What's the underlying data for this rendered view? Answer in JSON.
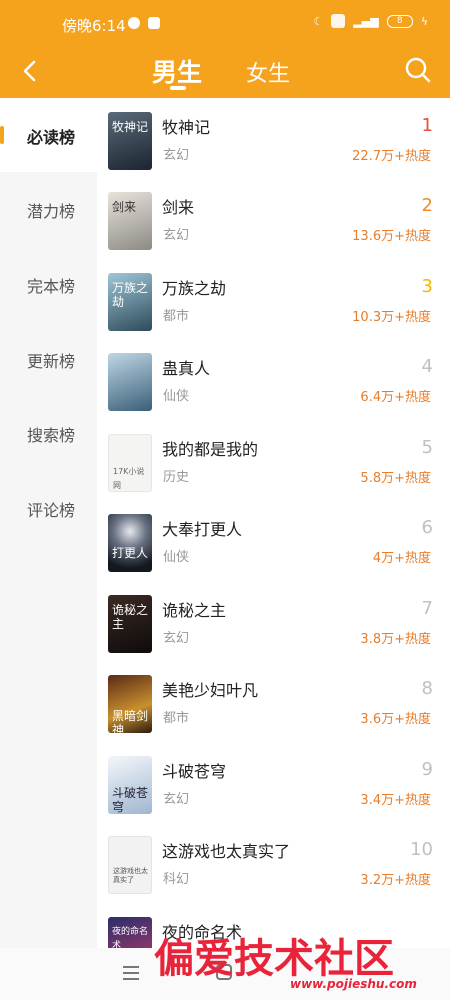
{
  "status": {
    "time": "傍晚6:14",
    "battery": "8"
  },
  "header": {
    "tab_male": "男生",
    "tab_female": "女生"
  },
  "sidebar": {
    "items": [
      {
        "label": "必读榜",
        "active": true
      },
      {
        "label": "潜力榜"
      },
      {
        "label": "完本榜"
      },
      {
        "label": "更新榜"
      },
      {
        "label": "搜索榜"
      },
      {
        "label": "评论榜"
      }
    ]
  },
  "books": [
    {
      "rank": "1",
      "title": "牧神记",
      "genre": "玄幻",
      "heat": "22.7万+热度",
      "cover_text": "牧神记"
    },
    {
      "rank": "2",
      "title": "剑来",
      "genre": "玄幻",
      "heat": "13.6万+热度",
      "cover_text": "剑来"
    },
    {
      "rank": "3",
      "title": "万族之劫",
      "genre": "都市",
      "heat": "10.3万+热度",
      "cover_text": "万族之劫"
    },
    {
      "rank": "4",
      "title": "蛊真人",
      "genre": "仙侠",
      "heat": "6.4万+热度",
      "cover_text": ""
    },
    {
      "rank": "5",
      "title": "我的都是我的",
      "genre": "历史",
      "heat": "5.8万+热度",
      "cover_text": "17K小说网"
    },
    {
      "rank": "6",
      "title": "大奉打更人",
      "genre": "仙侠",
      "heat": "4万+热度",
      "cover_text": "打更人"
    },
    {
      "rank": "7",
      "title": "诡秘之主",
      "genre": "玄幻",
      "heat": "3.8万+热度",
      "cover_text": "诡秘之主"
    },
    {
      "rank": "8",
      "title": "美艳少妇叶凡",
      "genre": "都市",
      "heat": "3.6万+热度",
      "cover_text": "黑暗剑神"
    },
    {
      "rank": "9",
      "title": "斗破苍穹",
      "genre": "玄幻",
      "heat": "3.4万+热度",
      "cover_text": "斗破苍穹"
    },
    {
      "rank": "10",
      "title": "这游戏也太真实了",
      "genre": "科幻",
      "heat": "3.2万+热度",
      "cover_text": "这游戏也太真实了"
    },
    {
      "rank": "",
      "title": "夜的命名术",
      "genre": "",
      "heat": "",
      "cover_text": "夜的命名术"
    }
  ],
  "colors": {
    "accent": "#f5a21c",
    "rank1": "#e8503a",
    "rank2": "#f08a2c",
    "rank3": "#f5b800",
    "rank_other": "#c0c0c0",
    "heat": "#e87d2b"
  },
  "watermark": {
    "main": "偏爱技术社区",
    "url": "www.pojieshu.com"
  }
}
